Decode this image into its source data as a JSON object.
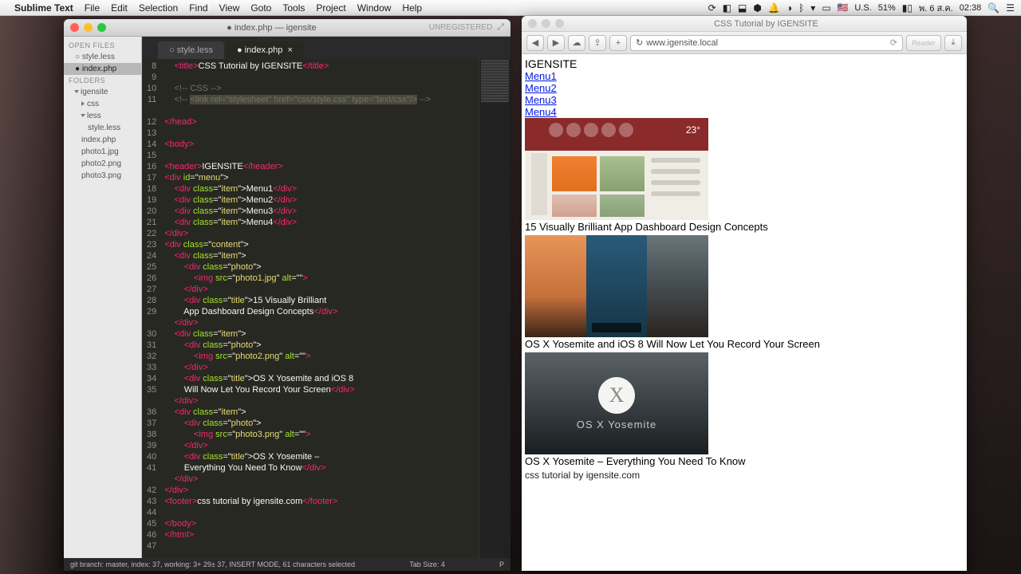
{
  "menubar": {
    "app": "Sublime Text",
    "items": [
      "File",
      "Edit",
      "Selection",
      "Find",
      "View",
      "Goto",
      "Tools",
      "Project",
      "Window",
      "Help"
    ],
    "right": {
      "flag": "US",
      "lang": "U.S.",
      "battery": "51%",
      "date": "พ. 6 ส.ค.",
      "time": "02:38"
    }
  },
  "sublime": {
    "title": "index.php — igensite",
    "unregistered": "UNREGISTERED",
    "sidebar": {
      "open_files": "OPEN FILES",
      "files": [
        "style.less",
        "index.php"
      ],
      "folders": "FOLDERS",
      "project": "igensite",
      "css": "css",
      "less": "less",
      "styleless": "style.less",
      "indexphp": "index.php",
      "photos": [
        "photo1.jpg",
        "photo2.png",
        "photo3.png"
      ]
    },
    "tabs": {
      "t1": "style.less",
      "t2": "index.php"
    },
    "status": {
      "left": "git branch: master, index: 37, working: 3+ 29± 37, INSERT MODE, 61 characters selected",
      "mid": "Tab Size: 4",
      "right": "P"
    },
    "lines": [
      8,
      9,
      10,
      11,
      12,
      13,
      14,
      15,
      16,
      17,
      18,
      19,
      20,
      21,
      22,
      23,
      24,
      25,
      26,
      27,
      28,
      29,
      30,
      31,
      32,
      33,
      34,
      35,
      36,
      37,
      38,
      39,
      40,
      41,
      42,
      43,
      44,
      45,
      46,
      47
    ]
  },
  "code": {
    "l8a": "<title>",
    "l8b": "CSS Tutorial by IGENSITE",
    "l8c": "</title>",
    "l10": "<!-- CSS -->",
    "l11a": "<!-- ",
    "l11b": "<link rel=\"stylesheet\" href=\"css/style.css\" type=\"text/css\"/>",
    "l11c": " -->",
    "l13": "</head>",
    "l15": "<body>",
    "l17a": "<header>",
    "l17b": "IGENSITE",
    "l17c": "</header>",
    "l18a": "<div ",
    "l18b": "id",
    "l18c": "=\"",
    "l18d": "menu",
    "l18e": "\">",
    "item_open": "<div ",
    "class": "class",
    "eq": "=\"",
    "item": "item",
    "close": "\">",
    "div_close": "</div>",
    "m1": "Menu1",
    "m2": "Menu2",
    "m3": "Menu3",
    "m4": "Menu4",
    "l24d": "content",
    "photo": "photo",
    "title": "title",
    "img_open": "<img ",
    "src": "src",
    "p1": "photo1.jpg",
    "p2": "photo2.png",
    "p3": "photo3.png",
    "alt": " alt",
    "altv": "=\"\"",
    "img_close": ">",
    "t1": "15 Visually Brilliant App Dashboard Design Concepts",
    "t2": "OS X Yosemite and iOS 8 Will Now Let You Record Your Screen",
    "t3": "OS X Yosemite – Everything You Need To Know",
    "footer_open": "<footer>",
    "footer_txt": "css tutorial by igensite.com",
    "footer_close": "</footer>",
    "body_close": "</body>",
    "html_close": "</html>"
  },
  "safari": {
    "title": "CSS Tutorial by IGENSITE",
    "url": "www.igensite.local",
    "reader": "Reader",
    "page": {
      "header": "IGENSITE",
      "menu": [
        "Menu1",
        "Menu2",
        "Menu3",
        "Menu4"
      ],
      "cap1": "15 Visually Brilliant App Dashboard Design Concepts",
      "cap2": "OS X Yosemite and iOS 8 Will Now Let You Record Your Screen",
      "cap3": "OS X Yosemite – Everything You Need To Know",
      "footer": "css tutorial by igensite.com",
      "xlabel": "OS X Yosemite",
      "temp": "23°"
    }
  }
}
